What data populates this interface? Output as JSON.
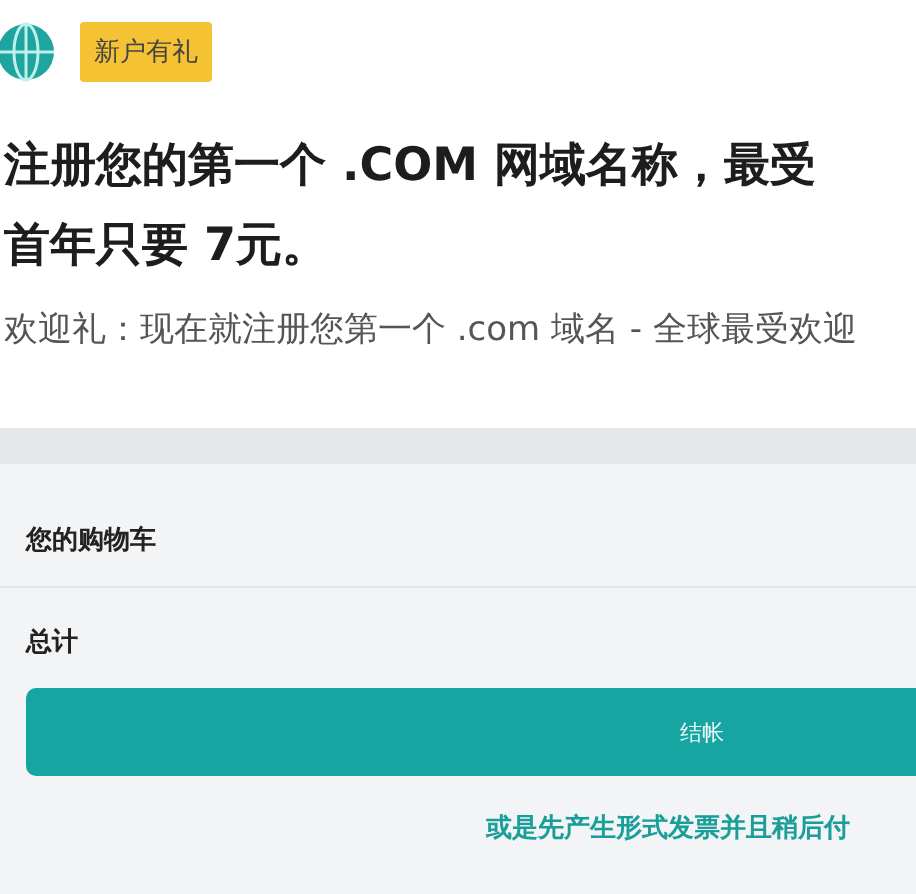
{
  "promo": {
    "badge": "新户有礼",
    "heading_lines": [
      "注册您的第一个 .COM 网域名称，最受",
      "首年只要 7元。"
    ],
    "subtitle": "欢迎礼：现在就注册您第一个 .com 域名 - 全球最受欢迎"
  },
  "cart": {
    "title": "您的购物车",
    "total_label": "总计",
    "checkout_button": "结帐",
    "invoice_link": "或是先产生形式发票并且稍后付"
  }
}
